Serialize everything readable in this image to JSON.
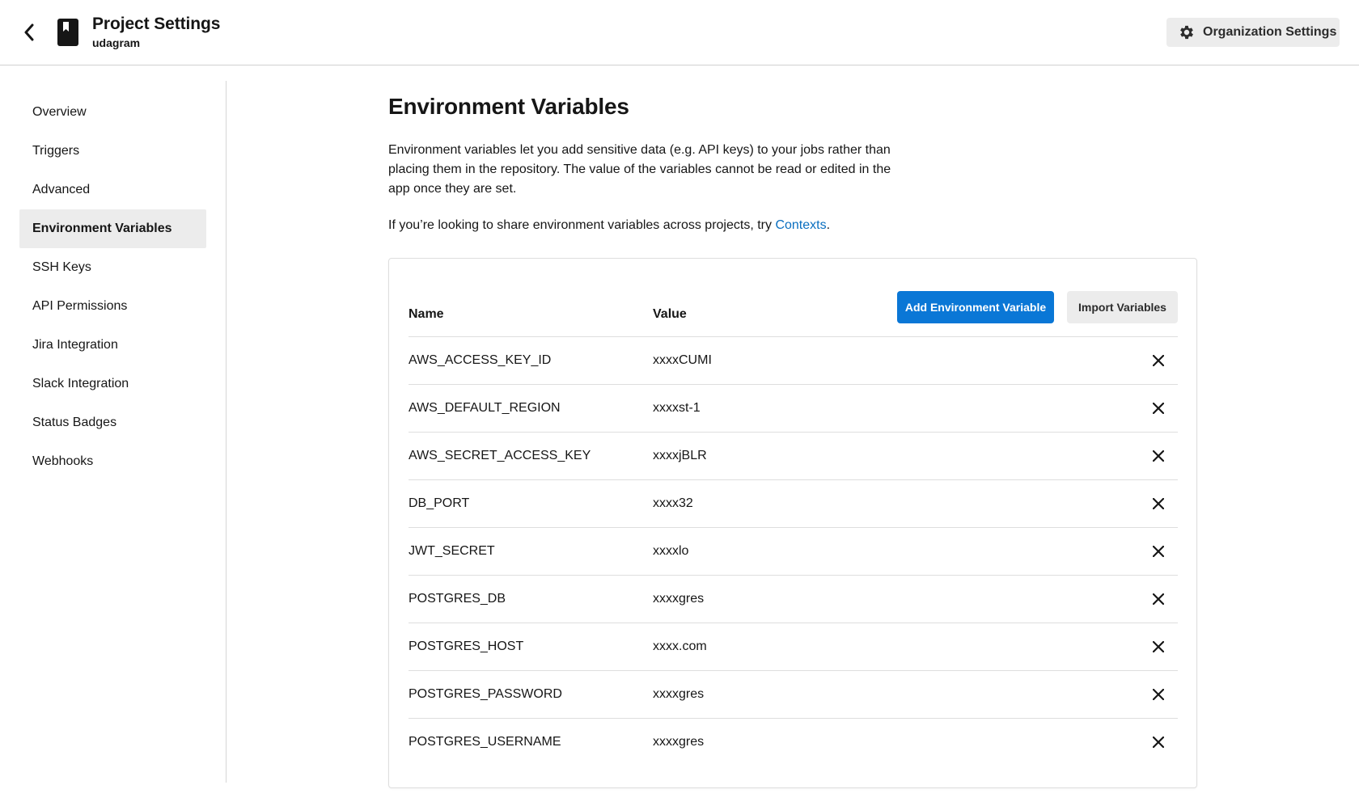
{
  "header": {
    "back_icon": "chevron-left-icon",
    "project_icon": "bookmark-book-icon",
    "title": "Project Settings",
    "subtitle": "udagram",
    "org_settings_label": "Organization Settings",
    "org_settings_icon": "gear-icon"
  },
  "sidebar": {
    "items": [
      {
        "label": "Overview",
        "active": false
      },
      {
        "label": "Triggers",
        "active": false
      },
      {
        "label": "Advanced",
        "active": false
      },
      {
        "label": "Environment Variables",
        "active": true
      },
      {
        "label": "SSH Keys",
        "active": false
      },
      {
        "label": "API Permissions",
        "active": false
      },
      {
        "label": "Jira Integration",
        "active": false
      },
      {
        "label": "Slack Integration",
        "active": false
      },
      {
        "label": "Status Badges",
        "active": false
      },
      {
        "label": "Webhooks",
        "active": false
      }
    ]
  },
  "main": {
    "title": "Environment Variables",
    "description": "Environment variables let you add sensitive data (e.g. API keys) to your jobs rather than placing them in the repository. The value of the variables cannot be read or edited in the app once they are set.",
    "share_text": "If you’re looking to share environment variables across projects, try ",
    "share_link": "Contexts",
    "share_end": ".",
    "table": {
      "col_name": "Name",
      "col_value": "Value",
      "add_button": "Add Environment Variable",
      "import_button": "Import Variables",
      "delete_icon": "close-icon",
      "rows": [
        {
          "name": "AWS_ACCESS_KEY_ID",
          "value": "xxxxCUMI"
        },
        {
          "name": "AWS_DEFAULT_REGION",
          "value": "xxxxst-1"
        },
        {
          "name": "AWS_SECRET_ACCESS_KEY",
          "value": "xxxxjBLR"
        },
        {
          "name": "DB_PORT",
          "value": "xxxx32"
        },
        {
          "name": "JWT_SECRET",
          "value": "xxxxlo"
        },
        {
          "name": "POSTGRES_DB",
          "value": "xxxxgres"
        },
        {
          "name": "POSTGRES_HOST",
          "value": "xxxx.com"
        },
        {
          "name": "POSTGRES_PASSWORD",
          "value": "xxxxgres"
        },
        {
          "name": "POSTGRES_USERNAME",
          "value": "xxxxgres"
        }
      ]
    }
  },
  "colors": {
    "primary": "#0a77d6",
    "link": "#0a6fc0",
    "active_nav_bg": "#ececec",
    "border": "#dedede"
  }
}
